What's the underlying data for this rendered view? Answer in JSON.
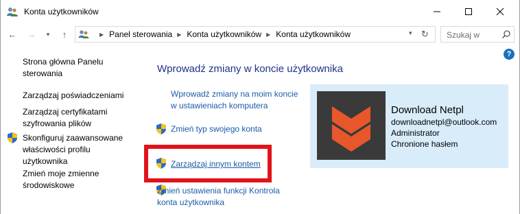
{
  "window": {
    "title": "Konta użytkowników",
    "minimize_glyph": "—",
    "maximize_glyph": "☐",
    "close_glyph": "✕"
  },
  "nav": {
    "back_glyph": "←",
    "forward_glyph": "→",
    "recent_glyph": "▾",
    "up_glyph": "↑"
  },
  "address": {
    "crumbs": [
      "Panel sterowania",
      "Konta użytkowników",
      "Konta użytkowników"
    ],
    "dropdown_glyph": "▾",
    "refresh_glyph": "↻"
  },
  "search": {
    "placeholder": "Szukaj w"
  },
  "help": {
    "glyph": "?"
  },
  "sidebar": {
    "items": [
      {
        "label": "Strona główna Panelu sterowania",
        "shield": false
      },
      {
        "label": "Zarządzaj poświadczeniami",
        "shield": false
      },
      {
        "label": "Zarządzaj certyfikatami szyfrowania plików",
        "shield": false
      },
      {
        "label": "Skonfiguruj zaawansowane właściwości profilu użytkownika",
        "shield": true
      },
      {
        "label": "Zmień moje zmienne środowiskowe",
        "shield": false
      }
    ]
  },
  "main": {
    "title": "Wprowadź zmiany w koncie użytkownika",
    "tasks": [
      {
        "label": "Wprowadź zmiany na moim koncie w ustawieniach komputera",
        "shield": false
      },
      {
        "label": "Zmień typ swojego konta",
        "shield": true
      },
      {
        "label": "Zarządzaj innym kontem",
        "shield": true,
        "highlighted": true
      },
      {
        "label": "Zmień ustawienia funkcji Kontrola konta użytkownika",
        "shield": true
      }
    ]
  },
  "user": {
    "name": "Download Netpl",
    "email": "downloadnetpl@outlook.com",
    "role": "Administrator",
    "protection": "Chronione hasłem"
  },
  "colors": {
    "link": "#1a5ba6",
    "heading": "#1e3287",
    "card_bg": "#d9ecfa",
    "avatar_bg": "#3a3a3a",
    "avatar_chevron": "#e8572b",
    "highlight_box": "#e1141b",
    "help_icon": "#1e6fc1"
  },
  "icons": {
    "title": "users-icon",
    "address": "control-panel-icon",
    "search": "search-icon",
    "shield": "uac-shield-icon",
    "avatar": "chevron-logo-icon"
  }
}
